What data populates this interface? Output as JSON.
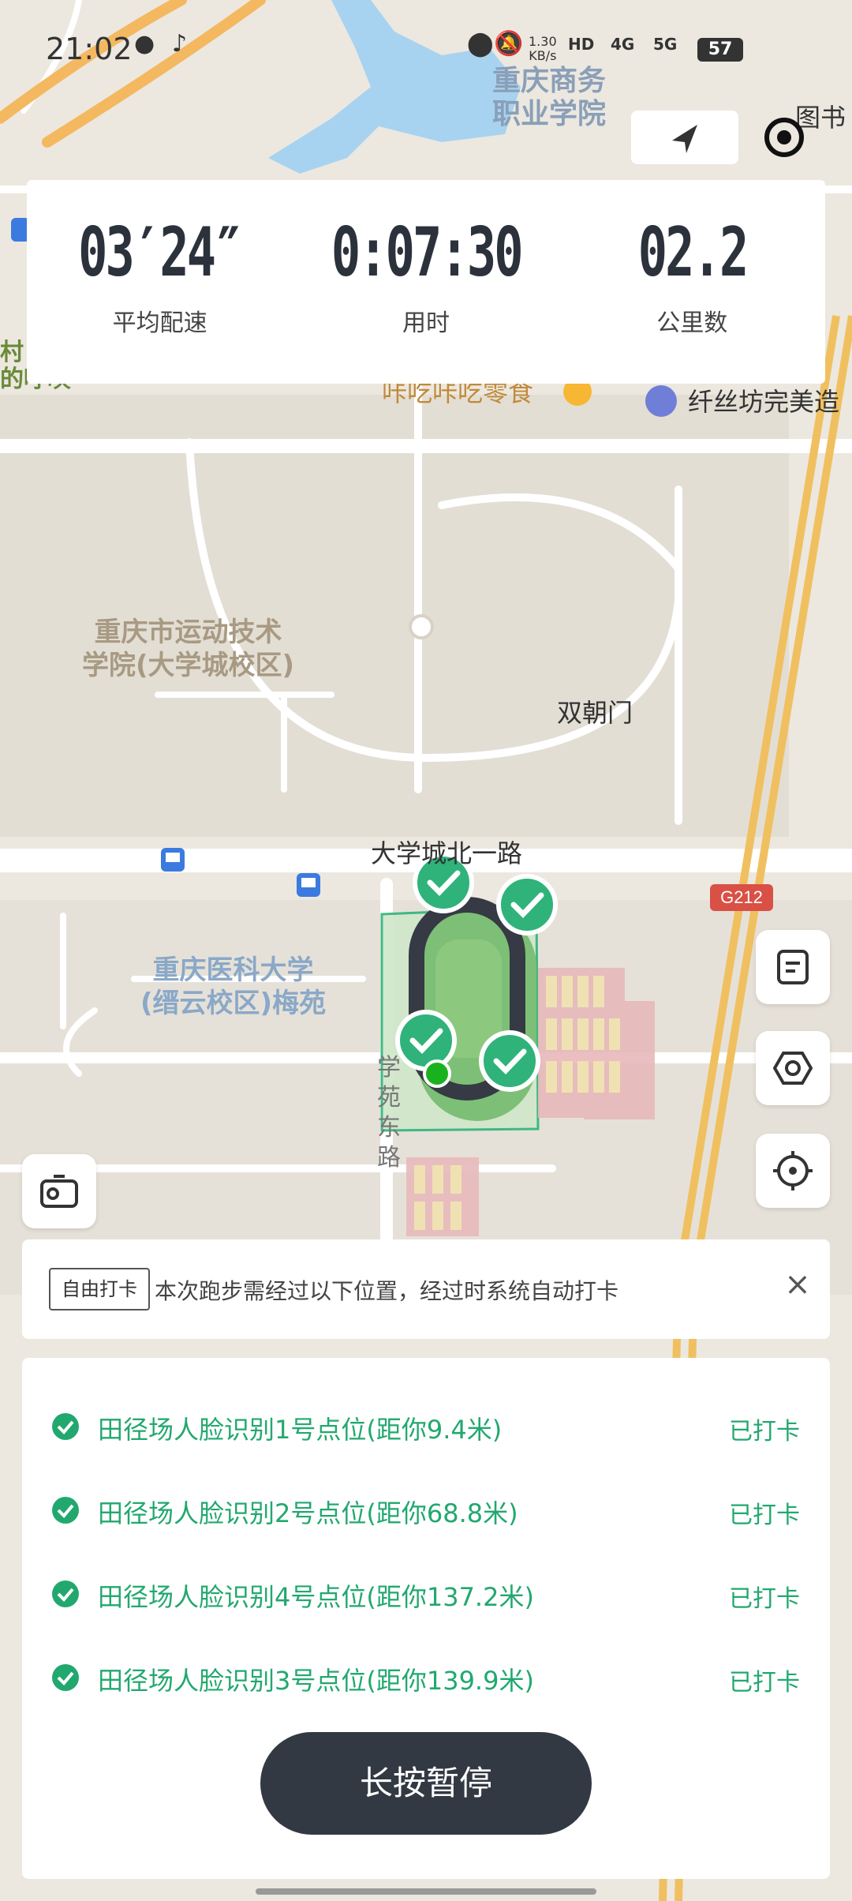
{
  "status_bar": {
    "time": "21:02",
    "net_speed_value": "1.30",
    "net_speed_unit": "KB/s",
    "network_1": "4G",
    "network_2": "5G",
    "battery": "57"
  },
  "stats": {
    "pace_value": "03′24″",
    "pace_label": "平均配速",
    "time_value": "0:07:30",
    "time_label": "用时",
    "distance_value": "02.2",
    "distance_label": "公里数"
  },
  "map": {
    "labels": {
      "school1_line1": "重庆商务",
      "school1_line2": "职业学院",
      "book": "图书",
      "snack": "咔吃咔吃零食",
      "salon": "纤丝坊完美造",
      "left_cut1": "村",
      "left_cut2": "的呼唤",
      "school2_line1": "重庆市运动技术",
      "school2_line2": "学院(大学城校区)",
      "gate": "双朝门",
      "road_north": "大学城北一路",
      "highway": "G212",
      "school3_line1": "重庆医科大学",
      "school3_line2": "(缙云校区)梅苑",
      "road_east_1": "学",
      "road_east_2": "苑",
      "road_east_3": "东",
      "road_east_4": "路"
    }
  },
  "notice": {
    "tag": "自由打卡",
    "text": "本次跑步需经过以下位置，经过时系统自动打卡",
    "close_glyph": "×"
  },
  "checkpoints": [
    {
      "name": "田径场人脸识别1号点位(距你9.4米)",
      "status": "已打卡"
    },
    {
      "name": "田径场人脸识别2号点位(距你68.8米)",
      "status": "已打卡"
    },
    {
      "name": "田径场人脸识别4号点位(距你137.2米)",
      "status": "已打卡"
    },
    {
      "name": "田径场人脸识别3号点位(距你139.9米)",
      "status": "已打卡"
    }
  ],
  "pause_button": "长按暂停",
  "colors": {
    "accent": "#22a86f",
    "dark": "#333943"
  }
}
